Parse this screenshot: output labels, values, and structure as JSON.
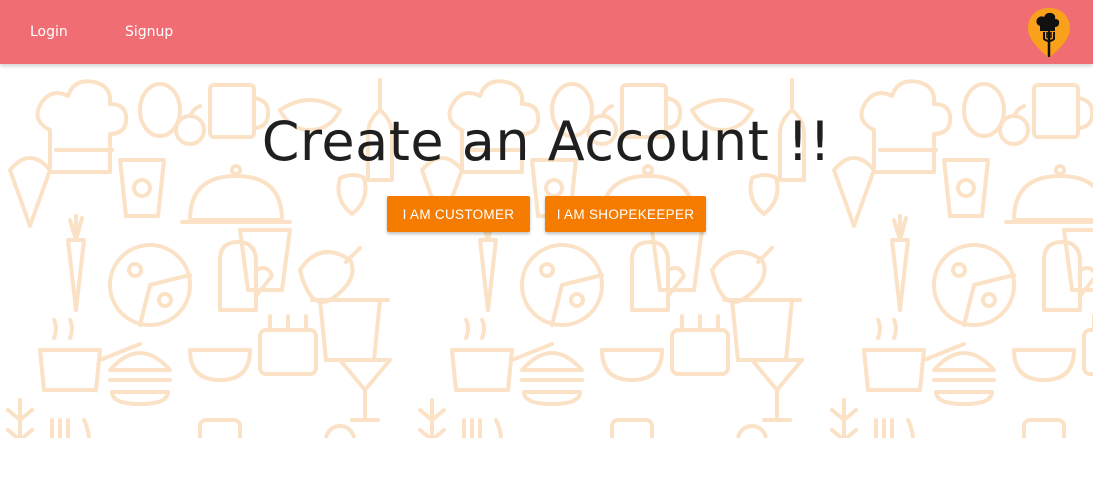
{
  "theme": {
    "navbar_color": "#f06e73",
    "button_color": "#f57c00",
    "logo_color": "#f9a11b",
    "pattern_color": "#fbe2c6"
  },
  "navbar": {
    "links": [
      {
        "label": "Login"
      },
      {
        "label": "Signup"
      }
    ],
    "logo_icon": "chef-hat-fork-pin-icon"
  },
  "main": {
    "title": "Create an Account !!",
    "buttons": [
      {
        "label": "I AM CUSTOMER"
      },
      {
        "label": "I AM SHOPEKEEPER"
      }
    ]
  },
  "background": {
    "pattern_icon": "food-doodle-pattern"
  }
}
